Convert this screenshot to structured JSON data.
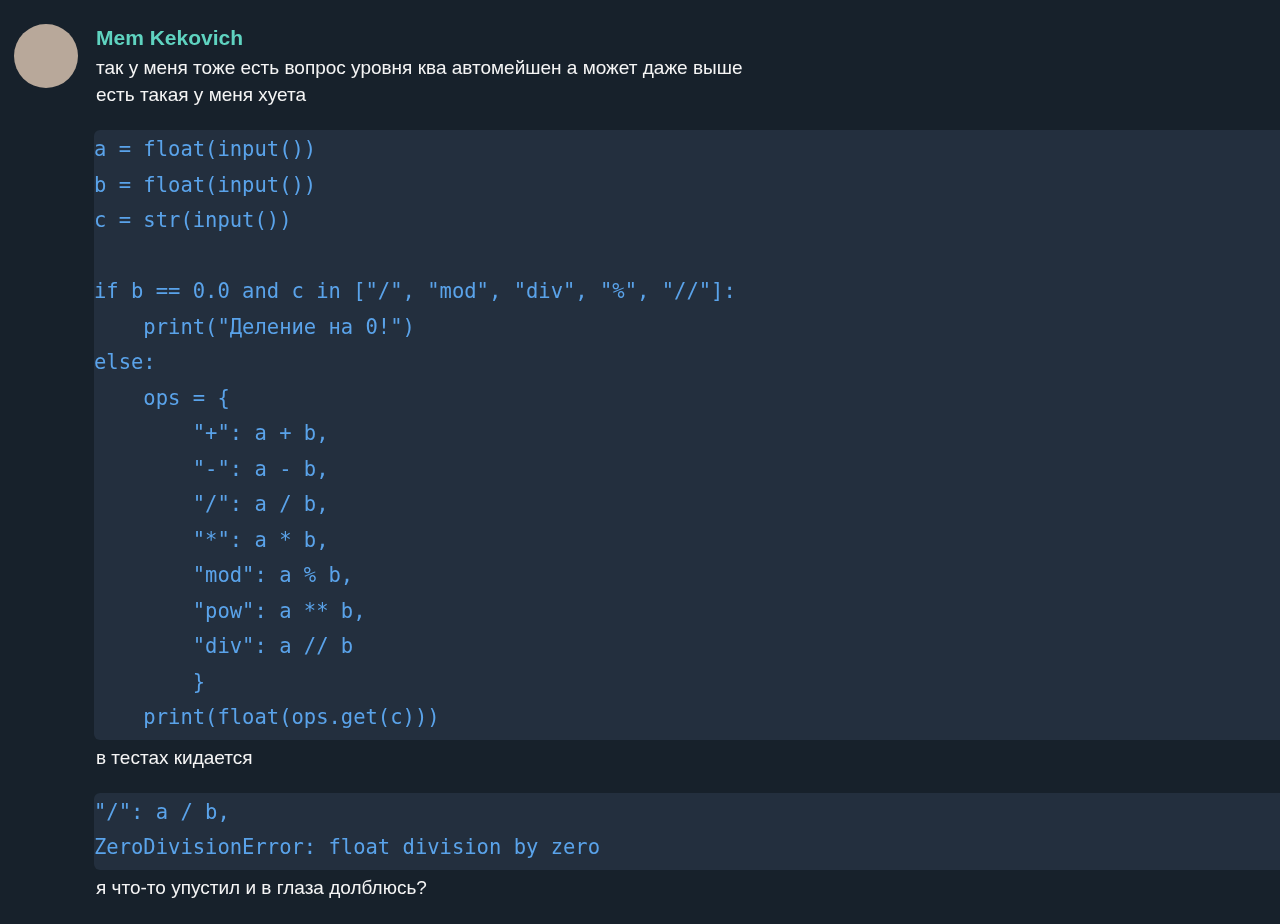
{
  "message": {
    "author": "Mem Kekovich",
    "parts": [
      {
        "kind": "text",
        "text": "так у меня тоже есть вопрос уровня ква автомейшен а может даже выше\nесть такая у меня хуета"
      },
      {
        "kind": "code",
        "text": "a = float(input())\nb = float(input())\nc = str(input())\n\nif b == 0.0 and c in [\"/\", \"mod\", \"div\", \"%\", \"//\"]:\n    print(\"Деление на 0!\")\nelse:\n    ops = {\n        \"+\": a + b,\n        \"-\": a - b,\n        \"/\": a / b,\n        \"*\": a * b,\n        \"mod\": a % b,\n        \"pow\": a ** b,\n        \"div\": a // b\n        }\n    print(float(ops.get(c)))"
      },
      {
        "kind": "text",
        "text": "в тестах кидается"
      },
      {
        "kind": "code",
        "text": "\"/\": a / b,\nZeroDivisionError: float division by zero"
      },
      {
        "kind": "text",
        "text": "я что-то упустил и в глаза долблюсь?"
      }
    ]
  }
}
